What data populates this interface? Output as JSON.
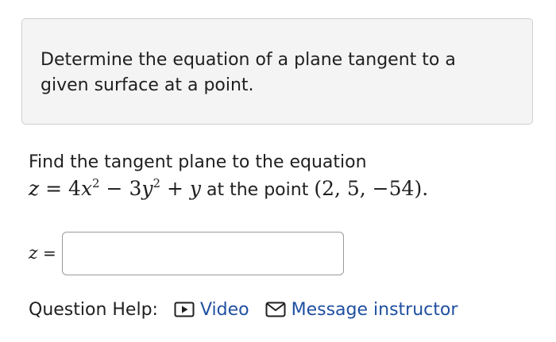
{
  "intro": {
    "text": "Determine the equation of a plane tangent to a given surface at a point."
  },
  "question": {
    "line1": "Find the tangent plane to the equation",
    "equation": {
      "lhs": "z",
      "eq": "=",
      "c1": "4",
      "x": "x",
      "exp1": "2",
      "minus": "−",
      "c2": "3",
      "y1": "y",
      "exp2": "2",
      "plus": "+",
      "y2": "y"
    },
    "mid_text": "at the point",
    "point": "(2, 5, −54)."
  },
  "answer": {
    "variable": "z",
    "equals": "=",
    "value": "",
    "placeholder": ""
  },
  "help": {
    "label": "Question Help:",
    "video_label": "Video",
    "video_icon": "play-video-icon",
    "message_label": "Message instructor",
    "message_icon": "envelope-icon",
    "link_color": "#1f4fa0"
  }
}
